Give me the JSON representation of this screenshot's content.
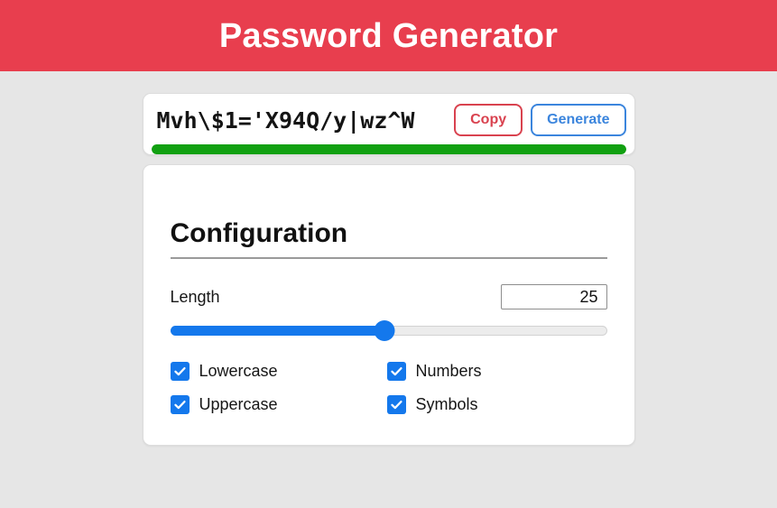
{
  "header": {
    "title": "Password Generator",
    "background_color": "#e83e4e",
    "text_color": "#ffffff"
  },
  "password_card": {
    "password_value": "Mvh\\$1='X94Q/y|wz^W",
    "password_placeholder": "",
    "copy_label": "Copy",
    "generate_label": "Generate",
    "copy_color": "#d9424f",
    "generate_color": "#3b85dd",
    "strength_percent": 100,
    "strength_color": "#11a011"
  },
  "config": {
    "title": "Configuration",
    "length": {
      "label": "Length",
      "value": "25",
      "slider_percent": 49,
      "slider_color": "#1478ec"
    },
    "options": [
      {
        "label": "Lowercase",
        "checked": true
      },
      {
        "label": "Numbers",
        "checked": true
      },
      {
        "label": "Uppercase",
        "checked": true
      },
      {
        "label": "Symbols",
        "checked": true
      }
    ],
    "checkbox_color": "#1478ec"
  },
  "page": {
    "background_color": "#e6e6e6",
    "card_background": "#ffffff"
  }
}
